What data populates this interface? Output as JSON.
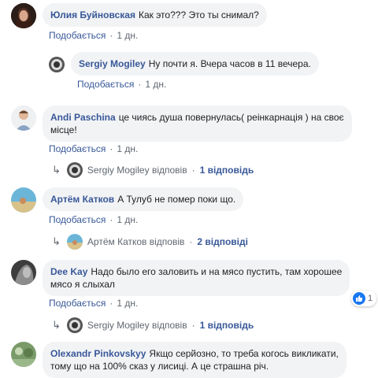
{
  "colors": {
    "author": "#385898",
    "bubble": "#f2f3f5",
    "meta": "#606770",
    "like": "#1877f2"
  },
  "comments": [
    {
      "author": "Юлия Буйновская",
      "text": "Как это??? Это ты снимал?",
      "reply_label": "Подобається",
      "time": "1 дн."
    },
    {
      "author": "Sergiy Mogiley",
      "text": "Ну почти я. Вчера часов в 11 вечера.",
      "reply_label": "Подобається",
      "time": "1 дн."
    },
    {
      "author": "Andi Paschina",
      "text_line1": "це чиясь душа повернулась( реінкарнація ) на своє",
      "text_line2": "місце!",
      "reply_label": "Подобається",
      "time": "1 дн.",
      "reply_author": "Sergiy Mogiley відповів",
      "reply_count": "1 відповідь"
    },
    {
      "author": "Артём Катков",
      "text": "А Тулуб не помер поки що.",
      "reply_label": "Подобається",
      "time": "1 дн.",
      "reply_author": "Артём Катков відповів",
      "reply_count": "2 відповіді"
    },
    {
      "author": "Dee Kay",
      "text_line1": "Надо было его заловить и на мясо пустить, там хорошее",
      "text_line2": "мясо я слыхал",
      "reply_label": "Подобається",
      "time": "1 дн.",
      "reactions_count": "1",
      "reply_author": "Sergiy Mogiley відповів",
      "reply_count": "1 відповідь"
    },
    {
      "author": "Olexandr Pinkovskyy",
      "text_line1": "Якщо серйозно, то треба когось викликати,",
      "text_line2": "тому що на 100% сказ у лисиці. А це страшна річ."
    }
  ]
}
